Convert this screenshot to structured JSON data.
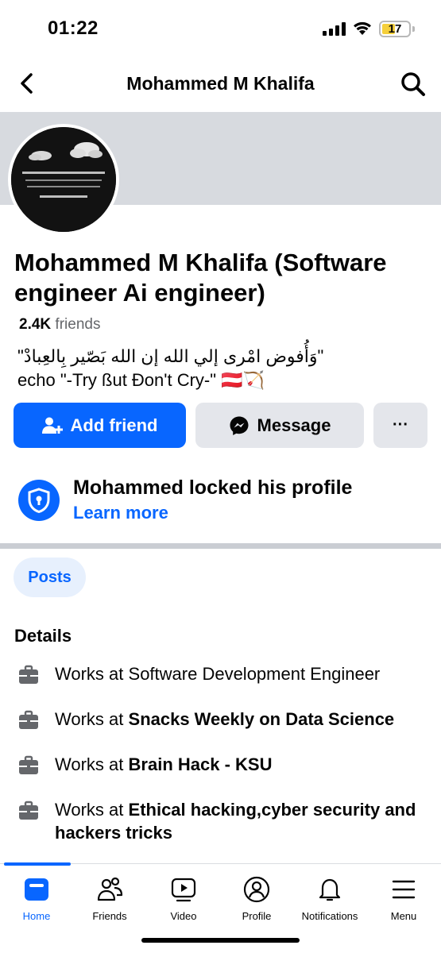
{
  "status": {
    "time": "01:22",
    "battery": "17"
  },
  "nav": {
    "title": "Mohammed M Khalifa"
  },
  "profile": {
    "name": "Mohammed M Khalifa (Software engineer  Ai engineer)",
    "friends_count": "2.4K",
    "friends_label": "friends",
    "bio_line1": "\"وَأُفوض امْرى إلي الله إن الله بَصّير بِالعِبادْ\"",
    "bio_line2": "echo \"-Try ßut Đon't Cry-\" 🇦🇹🏹"
  },
  "actions": {
    "add_friend": "Add friend",
    "message": "Message",
    "more": "···"
  },
  "lock": {
    "title": "Mohammed locked his profile",
    "link": "Learn more"
  },
  "tabs_chip": "Posts",
  "details": {
    "title": "Details",
    "items": [
      {
        "prefix": "Works at ",
        "bold": "",
        "plain": "Software Development Engineer"
      },
      {
        "prefix": "Works at ",
        "bold": "Snacks Weekly on Data Science",
        "plain": ""
      },
      {
        "prefix": "Works at ",
        "bold": "Brain Hack - KSU",
        "plain": ""
      },
      {
        "prefix": "Works at ",
        "bold": "Ethical hacking,cyber security and hackers tricks",
        "plain": ""
      }
    ]
  },
  "tabbar": [
    {
      "label": "Home",
      "icon": "home-icon"
    },
    {
      "label": "Friends",
      "icon": "friends-icon"
    },
    {
      "label": "Video",
      "icon": "video-icon"
    },
    {
      "label": "Profile",
      "icon": "profile-icon"
    },
    {
      "label": "Notifications",
      "icon": "bell-icon"
    },
    {
      "label": "Menu",
      "icon": "menu-icon"
    }
  ],
  "colors": {
    "accent": "#0866ff",
    "cover": "#d7dadf",
    "secondary_button": "#e4e6eb"
  }
}
